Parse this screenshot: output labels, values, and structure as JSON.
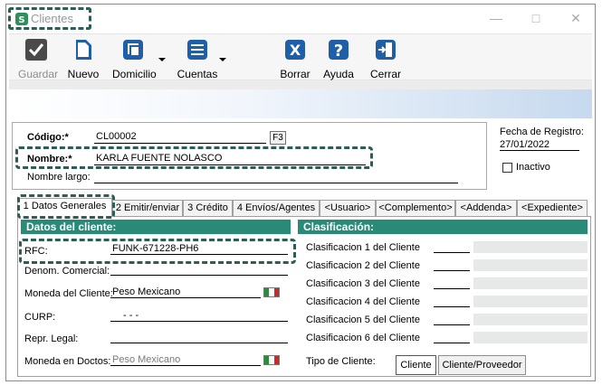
{
  "window": {
    "title": "Clientes",
    "app_icon": "green-s-icon",
    "controls": [
      "minimize-icon",
      "maximize-icon",
      "close-icon"
    ]
  },
  "toolbar": {
    "guardar": "Guardar",
    "nuevo": "Nuevo",
    "domicilio": "Domicilio",
    "cuentas": "Cuentas",
    "borrar": "Borrar",
    "ayuda": "Ayuda",
    "cerrar": "Cerrar"
  },
  "header": {
    "codigo_label": "Código:*",
    "codigo_value": "CL00002",
    "f3_label": "F3",
    "nombre_label": "Nombre:*",
    "nombre_value": "KARLA FUENTE NOLASCO",
    "nombre_largo_label": "Nombre largo:",
    "fecha_label": "Fecha de Registro:",
    "fecha_value": "27/01/2022",
    "inactivo_label": "Inactivo"
  },
  "tabs": [
    "1 Datos Generales",
    "2 Emitir/enviar",
    "3 Crédito",
    "4 Envíos/Agentes",
    "<Usuario>",
    "<Complemento>",
    "<Addenda>",
    "<Expediente>"
  ],
  "datos_cliente": {
    "header": "Datos del cliente:",
    "rfc_label": "RFC:",
    "rfc_value": "FUNK-671228-PH6",
    "denom_label": "Denom. Comercial:",
    "moneda_label": "Moneda del Cliente:",
    "moneda_value": "Peso Mexicano",
    "curp_label": "CURP:",
    "curp_value": "-   -   -",
    "repr_label": "Repr. Legal:",
    "moneda_doctos_label": "Moneda en Doctos:",
    "moneda_doctos_value": "Peso Mexicano"
  },
  "clasificacion": {
    "header": "Clasificación:",
    "items": [
      "Clasificacion 1 del Cliente",
      "Clasificacion 2 del Cliente",
      "Clasificacion 3 del Cliente",
      "Clasificacion 4 del Cliente",
      "Clasificacion 5 del Cliente",
      "Clasificacion 6 del Cliente"
    ],
    "tipo_label": "Tipo de Cliente:",
    "tipo_cliente": "Cliente",
    "tipo_cliente_proveedor": "Cliente/Proveedor"
  },
  "colors": {
    "section_header": "#2a8a78",
    "highlight_dash": "#2e5d57",
    "blue_icon": "#1f5fa8"
  }
}
